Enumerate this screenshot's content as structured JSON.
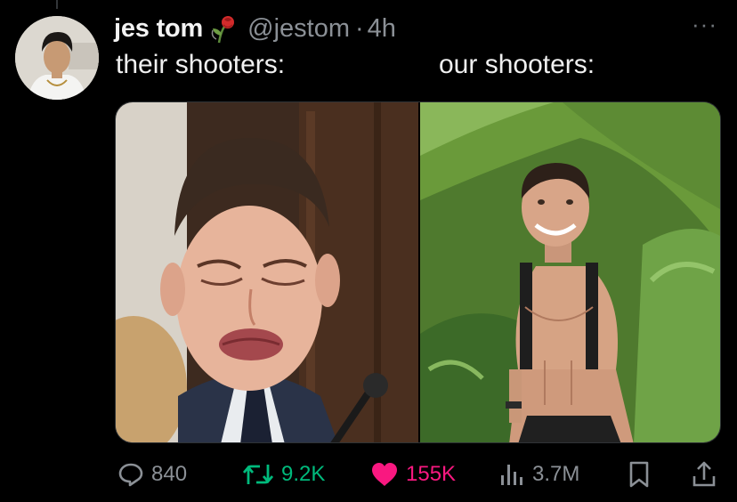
{
  "tweet": {
    "display_name": "jes tom",
    "handle": "@jestom",
    "timestamp": "4h",
    "separator": "·",
    "more_label": "···",
    "text_left": "their shooters:",
    "text_right": "our shooters:"
  },
  "actions": {
    "replies": "840",
    "reposts": "9.2K",
    "likes": "155K",
    "views": "3.7M"
  },
  "icons": {
    "reply": "reply-icon",
    "repost": "repost-icon",
    "like": "heart-icon",
    "views": "views-icon",
    "bookmark": "bookmark-icon",
    "share": "share-icon",
    "badge": "rose-icon"
  },
  "colors": {
    "background": "#000000",
    "text": "#e7e9ea",
    "muted": "#71767b",
    "repost_green": "#00ba7c",
    "like_pink": "#f91880",
    "icon_accent": "#1d9bf0"
  }
}
